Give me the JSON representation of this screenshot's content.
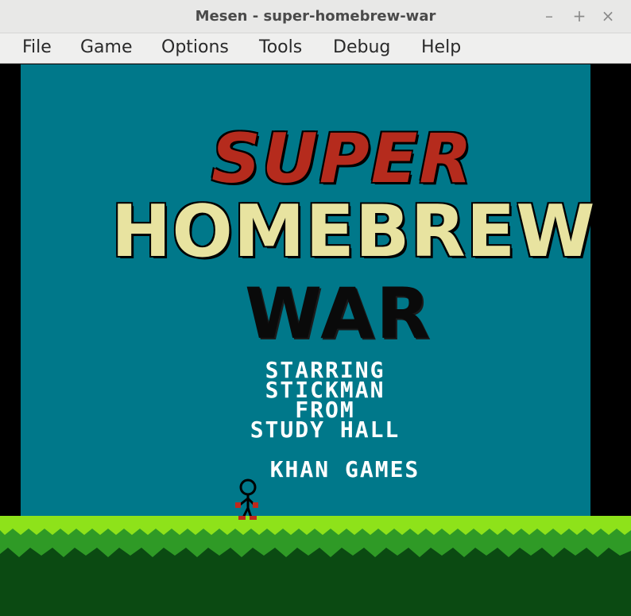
{
  "window": {
    "title": "Mesen - super-homebrew-war",
    "minimize_glyph": "–",
    "maximize_glyph": "+",
    "close_glyph": "×"
  },
  "menu": {
    "items": [
      "File",
      "Game",
      "Options",
      "Tools",
      "Debug",
      "Help"
    ]
  },
  "game": {
    "title_line1": "SUPER",
    "title_line2": "HOMEBREW",
    "title_line3": "WAR",
    "credit_line1": "STARRING",
    "credit_line2": "STICKMAN",
    "credit_line3": "FROM",
    "credit_line4": "STUDY HALL",
    "publisher": "KHAN GAMES"
  },
  "colors": {
    "background_teal": "#00788a",
    "title_red": "#b52b1d",
    "title_cream": "#e8e3a0",
    "title_black": "#0a0a0a",
    "grass_light": "#8ee21a",
    "grass_mid": "#2f9a26",
    "grass_dark": "#0b4a12"
  },
  "icons": {
    "minimize": "minimize-icon",
    "maximize": "maximize-icon",
    "close": "close-icon",
    "player": "stickman-sprite"
  }
}
